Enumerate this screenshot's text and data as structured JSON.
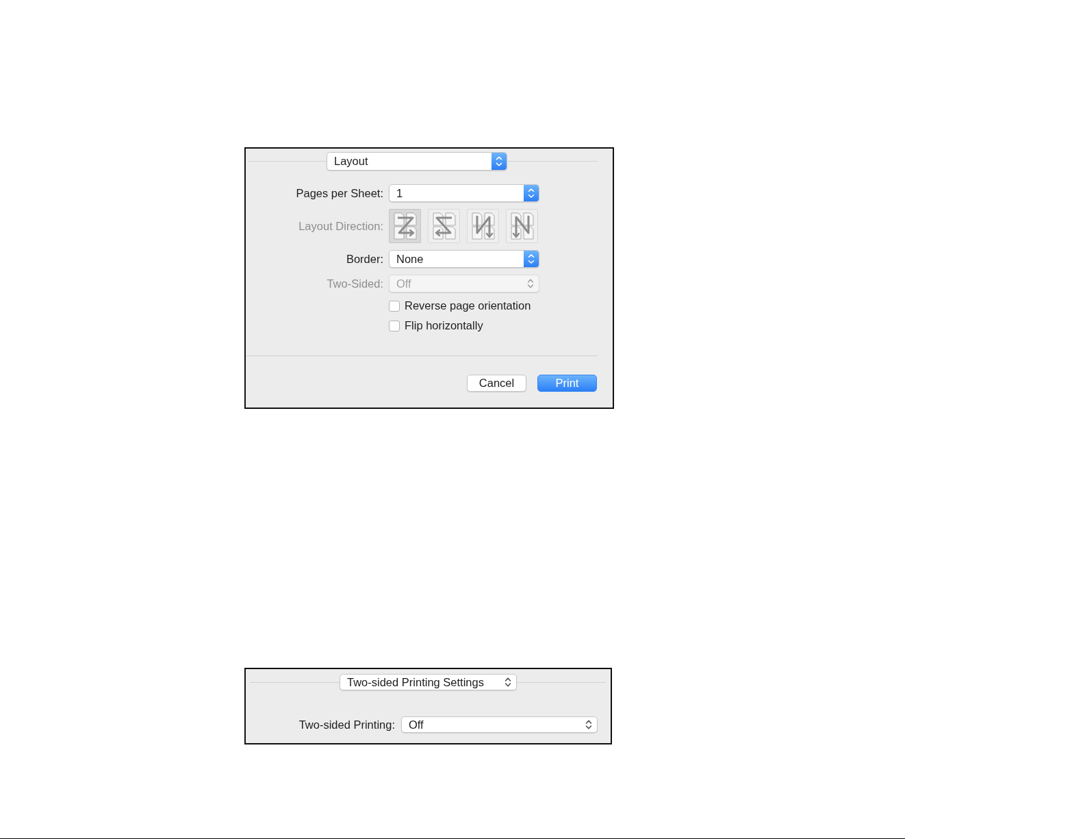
{
  "layout_dialog": {
    "active": true,
    "panel_menu": {
      "value": "Layout"
    },
    "rows": [
      {
        "kind": "popup",
        "label": "Pages per Sheet:",
        "value": "1",
        "disabled": false
      },
      {
        "kind": "direction",
        "label": "Layout Direction:",
        "disabled": true,
        "options": [
          {
            "kind": "z",
            "selected": true
          },
          {
            "kind": "s",
            "selected": false
          },
          {
            "kind": "reverse-n",
            "selected": false
          },
          {
            "kind": "n",
            "selected": false
          }
        ]
      },
      {
        "kind": "popup",
        "label": "Border:",
        "value": "None",
        "disabled": false
      },
      {
        "kind": "popup",
        "label": "Two-Sided:",
        "value": "Off",
        "disabled": true
      }
    ],
    "checkboxes": [
      {
        "label": "Reverse page orientation",
        "checked": false
      },
      {
        "label": "Flip horizontally",
        "checked": false
      }
    ],
    "buttons": [
      {
        "label": "Cancel",
        "default": false
      },
      {
        "label": "Print",
        "default": true
      }
    ]
  },
  "two_sided_dialog": {
    "active": false,
    "panel_menu": {
      "value": "Two-sided Printing Settings"
    },
    "rows": [
      {
        "kind": "popup",
        "label": "Two-sided Printing:",
        "value": "Off",
        "disabled": false
      }
    ]
  }
}
